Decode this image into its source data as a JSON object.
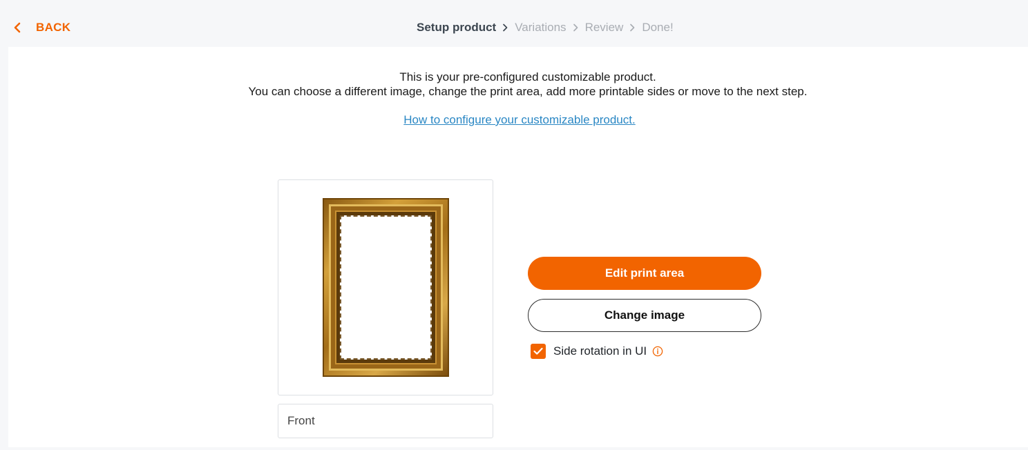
{
  "header": {
    "back_label": "BACK",
    "steps": [
      {
        "label": "Setup product",
        "active": true
      },
      {
        "label": "Variations",
        "active": false
      },
      {
        "label": "Review",
        "active": false
      },
      {
        "label": "Done!",
        "active": false
      }
    ]
  },
  "intro": {
    "line1": "This is your pre-configured customizable product.",
    "line2": "You can choose a different image, change the print area, add more printable sides or move to the next step.",
    "howto_link": "How to configure your customizable product."
  },
  "side": {
    "name_value": "Front"
  },
  "actions": {
    "edit_print_area": "Edit print area",
    "change_image": "Change image",
    "side_rotation_label": "Side rotation in UI",
    "side_rotation_checked": true
  },
  "icons": {
    "back": "chevron-left-icon",
    "step_separator": "chevron-right-icon",
    "checkbox": "checkmark-icon",
    "info": "info-icon"
  },
  "colors": {
    "accent": "#f26400",
    "link": "#2a87c4",
    "step_active": "#3c4650",
    "step_inactive": "#a9adb3"
  }
}
